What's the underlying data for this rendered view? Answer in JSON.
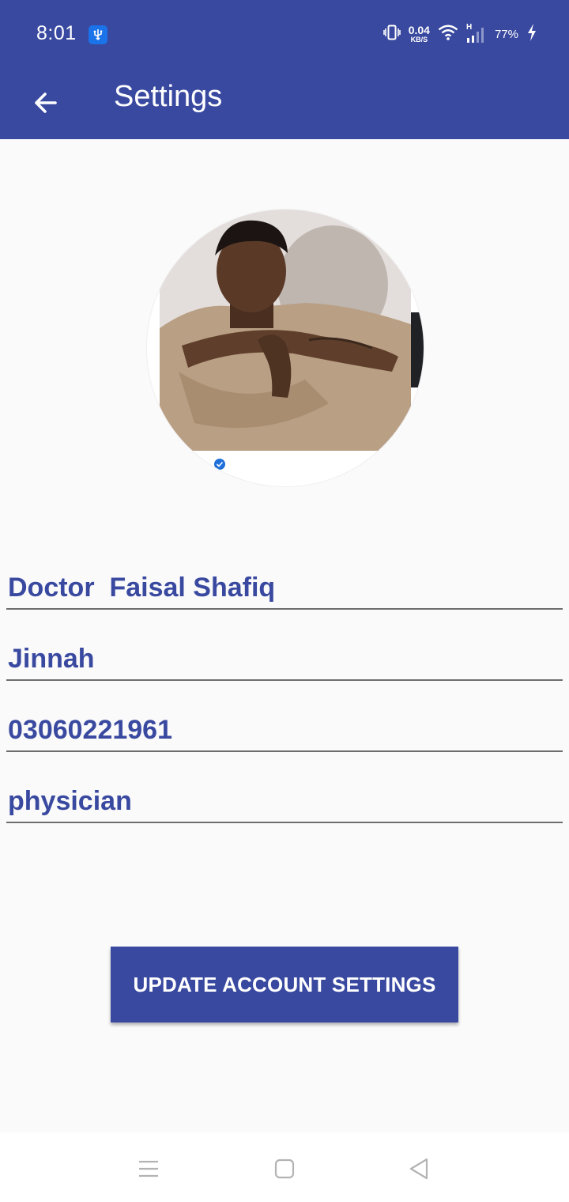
{
  "status_bar": {
    "time": "8:01",
    "net_speed_value": "0.04",
    "net_speed_unit": "KB/S",
    "signal_type": "H",
    "battery": "77%",
    "icons": [
      "usb-debug-icon",
      "vibrate-icon",
      "wifi-icon",
      "signal-icon",
      "charging-icon"
    ]
  },
  "app_bar": {
    "title": "Settings",
    "back_icon": "arrow-left-icon"
  },
  "profile": {
    "name": "Doctor  Faisal Shafiq",
    "city": "Jinnah",
    "phone": "03060221961",
    "profession": "physician"
  },
  "actions": {
    "update_label": "UPDATE ACCOUNT SETTINGS"
  },
  "nav_bar": {
    "icons": [
      "menu-icon",
      "home-icon",
      "back-triangle-icon"
    ]
  },
  "colors": {
    "primary": "#3949a0",
    "background": "#fafafa",
    "underline": "#6d6d6d"
  }
}
